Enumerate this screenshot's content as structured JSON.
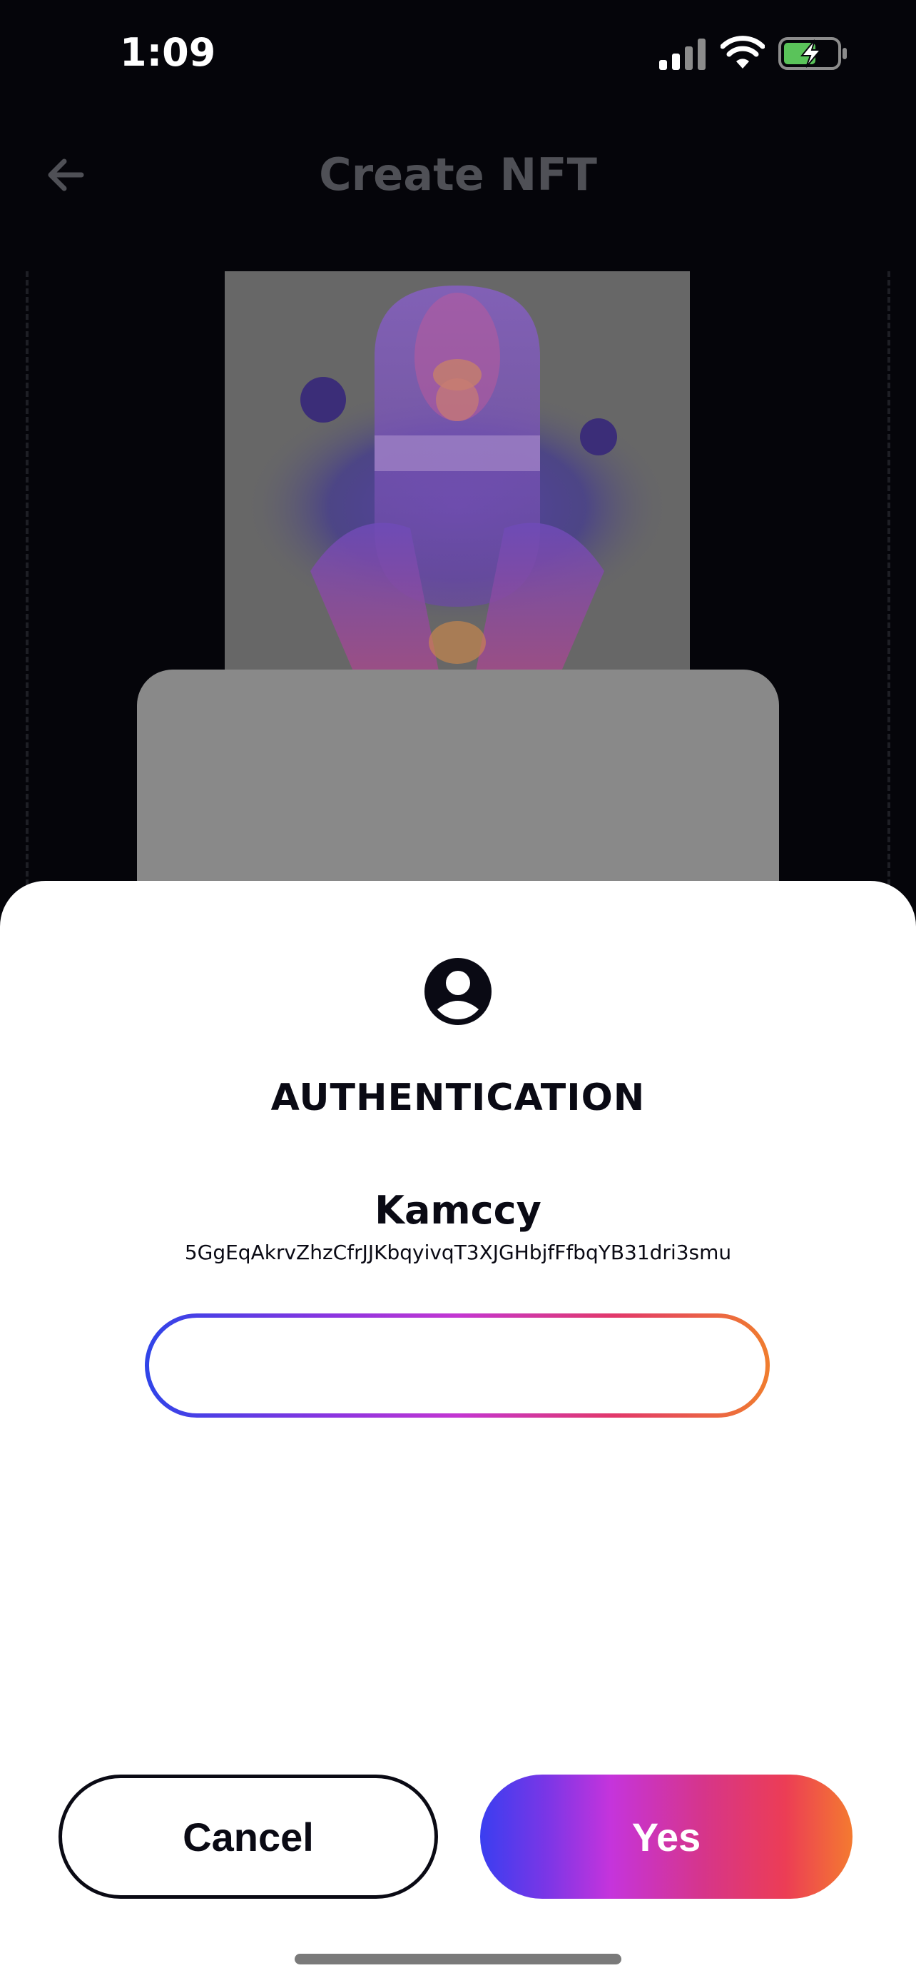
{
  "status_bar": {
    "time": "1:09",
    "icons": [
      "signal-icon",
      "wifi-icon",
      "battery-charging-icon"
    ],
    "battery_color": "#5ac35a"
  },
  "header": {
    "title": "Create NFT",
    "back_icon": "back-arrow-icon"
  },
  "nft_preview": {
    "image_subject": "glowing capsule held by hands with orbs"
  },
  "modal": {
    "icon": "user-circle-icon",
    "title": "AUTHENTICATION",
    "account_name": "Kamccy",
    "account_address": "5GgEqAkrvZhzCfrJJKbqyivqT3XJGHbjfFfbqYB31dri3smu",
    "password_value": "",
    "password_placeholder": "",
    "cancel_label": "Cancel",
    "yes_label": "Yes"
  },
  "colors": {
    "background": "#05050a",
    "sheet": "#ffffff",
    "text_dark": "#0a0a14",
    "gradient": [
      "#3a3ef0",
      "#c534dc",
      "#ec3d55",
      "#f47a30"
    ]
  }
}
